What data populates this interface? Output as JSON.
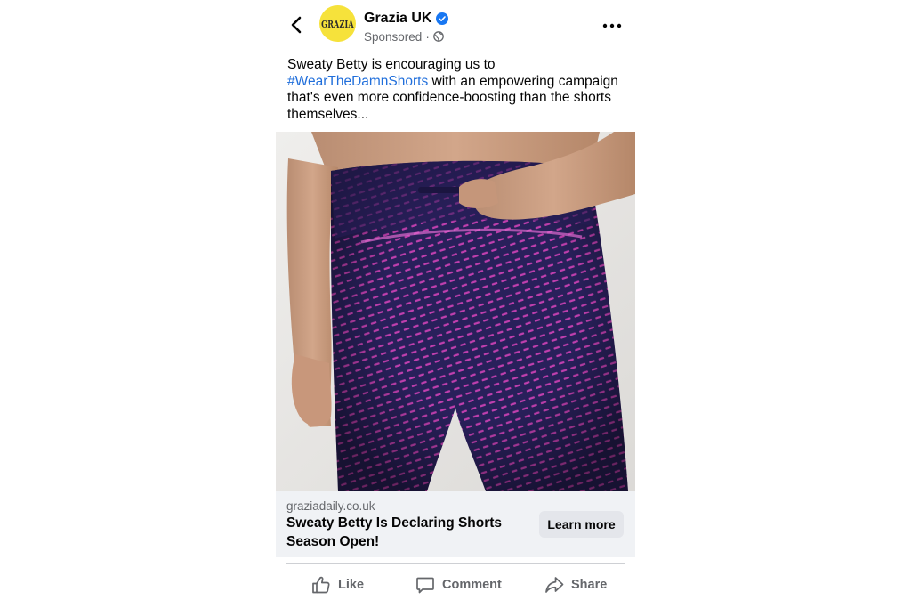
{
  "header": {
    "page_name": "Grazia UK",
    "avatar_text": "GRAZIA",
    "sponsored_label": "Sponsored",
    "separator": "·",
    "icons": {
      "back": "chevron-left-icon",
      "verified": "verified-badge-icon",
      "audience": "globe-icon",
      "more": "more-horizontal-icon"
    }
  },
  "caption": {
    "text_before": "Sweaty Betty is encouraging us to ",
    "hashtag": "#WearTheDamnShorts",
    "text_after": " with an empowering campaign that's even more confidence-boosting than the shorts themselves..."
  },
  "link_preview": {
    "domain": "graziadaily.co.uk",
    "headline": "Sweaty Betty Is Declaring Shorts Season Open!",
    "cta_label": "Learn more"
  },
  "actions": {
    "like_label": "Like",
    "comment_label": "Comment",
    "share_label": "Share",
    "icons": {
      "like": "thumbs-up-icon",
      "comment": "comment-bubble-icon",
      "share": "share-arrow-icon"
    }
  },
  "colors": {
    "hashtag": "#216fdb",
    "verified_badge": "#1877f2",
    "avatar_bg": "#f6e23b",
    "secondary_text": "#65676b",
    "link_box_bg": "#f0f2f5",
    "cta_bg": "#e4e6eb",
    "leggings_navy": "#2a1f5a",
    "leggings_pink": "#c13fb0"
  }
}
